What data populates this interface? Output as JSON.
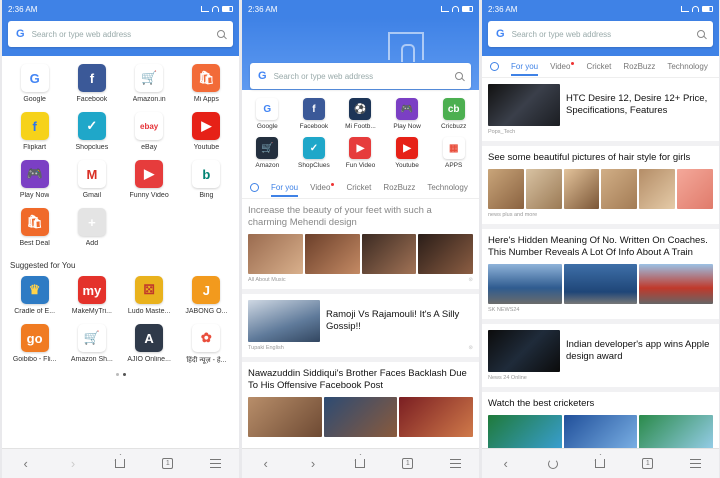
{
  "time": "2:36 AM",
  "search_placeholder": "Search or type web address",
  "google_letter": "G",
  "colors": {
    "accent": "#3f82e6"
  },
  "phone1": {
    "apps": [
      {
        "label": "Google",
        "glyph": "G",
        "bg": "#ffffff",
        "fg": "#4285f4",
        "icon": "google-icon"
      },
      {
        "label": "Facebook",
        "glyph": "f",
        "bg": "#3b5998",
        "fg": "#ffffff",
        "icon": "facebook-icon"
      },
      {
        "label": "Amazon.in",
        "glyph": "🛒",
        "bg": "#ffffff",
        "fg": "#f08804",
        "icon": "amazon-cart-icon"
      },
      {
        "label": "Mi Apps",
        "glyph": "🛍",
        "bg": "#f26b38",
        "fg": "#ffffff",
        "icon": "mi-apps-icon"
      },
      {
        "label": "Flipkart",
        "glyph": "f",
        "bg": "#f6d21a",
        "fg": "#2874f0",
        "icon": "flipkart-icon"
      },
      {
        "label": "Shopclues",
        "glyph": "✓",
        "bg": "#1fa7c9",
        "fg": "#ffffff",
        "icon": "shopclues-icon"
      },
      {
        "label": "eBay",
        "glyph": "ebay",
        "bg": "#ffffff",
        "fg": "#e53238",
        "icon": "ebay-icon"
      },
      {
        "label": "Youtube",
        "glyph": "▶",
        "bg": "#e62117",
        "fg": "#ffffff",
        "icon": "youtube-icon"
      },
      {
        "label": "Play Now",
        "glyph": "🎮",
        "bg": "#7b3fc4",
        "fg": "#ffffff",
        "icon": "gamepad-icon"
      },
      {
        "label": "Gmail",
        "glyph": "M",
        "bg": "#ffffff",
        "fg": "#d93025",
        "icon": "gmail-icon"
      },
      {
        "label": "Funny Video",
        "glyph": "▶",
        "bg": "#e63c3c",
        "fg": "#ffffff",
        "icon": "funny-video-icon"
      },
      {
        "label": "Bing",
        "glyph": "b",
        "bg": "#ffffff",
        "fg": "#008373",
        "icon": "bing-icon"
      },
      {
        "label": "Best Deal",
        "glyph": "🛍",
        "bg": "#f06a2a",
        "fg": "#ffffff",
        "icon": "best-deal-icon"
      },
      {
        "label": "Add",
        "glyph": "+",
        "bg": "#e4e4e4",
        "fg": "#ffffff",
        "icon": "add-icon"
      }
    ],
    "suggested_title": "Suggested for You",
    "suggested": [
      {
        "label": "Cradle of E...",
        "glyph": "♛",
        "bg": "#2e7bc4",
        "fg": "#ffd24a",
        "icon": "cradle-game-icon"
      },
      {
        "label": "MakeMyTri...",
        "glyph": "my",
        "bg": "#e4322b",
        "fg": "#ffffff",
        "icon": "makemytrip-icon"
      },
      {
        "label": "Ludo Maste...",
        "glyph": "⚄",
        "bg": "#e9b21d",
        "fg": "#c0392b",
        "icon": "ludo-icon"
      },
      {
        "label": "JABONG O...",
        "glyph": "J",
        "bg": "#f29a1d",
        "fg": "#ffffff",
        "icon": "jabong-icon"
      },
      {
        "label": "Goibibo - Fli...",
        "glyph": "go",
        "bg": "#f07b22",
        "fg": "#ffffff",
        "icon": "goibibo-icon"
      },
      {
        "label": "Amazon Sh...",
        "glyph": "🛒",
        "bg": "#ffffff",
        "fg": "#146eb4",
        "icon": "amazon-shopping-icon"
      },
      {
        "label": "AJIO Online...",
        "glyph": "A",
        "bg": "#2f3a4a",
        "fg": "#ffffff",
        "icon": "ajio-icon"
      },
      {
        "label": "हिंदी न्यूज़ - हे...",
        "glyph": "✿",
        "bg": "#ffffff",
        "fg": "#e94e3c",
        "icon": "dailyhunt-icon"
      }
    ]
  },
  "phone2": {
    "apps": [
      {
        "label": "Google",
        "glyph": "G",
        "bg": "#ffffff",
        "fg": "#4285f4",
        "icon": "google-icon"
      },
      {
        "label": "Facebook",
        "glyph": "f",
        "bg": "#3b5998",
        "fg": "#ffffff",
        "icon": "facebook-icon"
      },
      {
        "label": "Mi Footb...",
        "glyph": "⚽",
        "bg": "#1d3557",
        "fg": "#ffffff",
        "icon": "football-icon"
      },
      {
        "label": "Play Now",
        "glyph": "🎮",
        "bg": "#7b3fc4",
        "fg": "#ffffff",
        "icon": "gamepad-icon"
      },
      {
        "label": "Cricbuzz",
        "glyph": "cb",
        "bg": "#4caf50",
        "fg": "#ffffff",
        "icon": "cricbuzz-icon"
      },
      {
        "label": "Amazon",
        "glyph": "🛒",
        "bg": "#232f3e",
        "fg": "#f08804",
        "icon": "amazon-icon"
      },
      {
        "label": "ShopClues",
        "glyph": "✓",
        "bg": "#1fa7c9",
        "fg": "#ffffff",
        "icon": "shopclues-icon"
      },
      {
        "label": "Fun Video",
        "glyph": "▶",
        "bg": "#e63c3c",
        "fg": "#ffffff",
        "icon": "funny-video-icon"
      },
      {
        "label": "Youtube",
        "glyph": "▶",
        "bg": "#e62117",
        "fg": "#ffffff",
        "icon": "youtube-icon"
      },
      {
        "label": "APPS",
        "glyph": "▦",
        "bg": "#ffffff",
        "fg": "#e94e3c",
        "icon": "apps-grid-icon"
      }
    ],
    "tabs": [
      "For you",
      "Video",
      "Cricket",
      "RozBuzz",
      "Technology"
    ],
    "news": [
      {
        "title": "Increase the beauty of your feet with such a charming Mehendi design",
        "source": "All About Music"
      },
      {
        "title": "Ramoji Vs Rajamouli! It's A Silly Gossip!!",
        "source": "Tupaki English"
      },
      {
        "title": "Nawazuddin Siddiqui's Brother Faces Backlash Due To His Offensive Facebook Post",
        "source": ""
      }
    ]
  },
  "phone3": {
    "tabs": [
      "For you",
      "Video",
      "Cricket",
      "RozBuzz",
      "Technology"
    ],
    "news": [
      {
        "title": "HTC Desire 12, Desire 12+ Price, Specifications, Features",
        "source": "Pops_Tech"
      },
      {
        "title": "See some beautiful pictures of hair style for girls",
        "source": "news plus and more"
      },
      {
        "title": "Here's Hidden Meaning Of No. Written On Coaches. This Number Reveals A Lot Of Info About A Train",
        "source": "SK NEWS24"
      },
      {
        "title": "Indian developer's app wins Apple design award",
        "source": "News 24 Online"
      },
      {
        "title": "Watch the best cricketers",
        "source": ""
      }
    ]
  }
}
